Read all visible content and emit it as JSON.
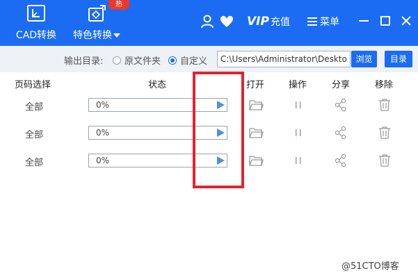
{
  "toolbar": {
    "cad_convert_label": "CAD转换",
    "special_convert_label": "特色转换",
    "hot_badge": "热",
    "vip_mark": "VIP",
    "vip_label": "充值",
    "menu_label": "菜单"
  },
  "output": {
    "label": "输出目录:",
    "option_original": "原文件夹",
    "option_custom": "自定义",
    "selected": "自定义",
    "path_value": "C:\\Users\\Administrator\\Deskto",
    "browse_label": "浏览",
    "directory_label": "目录"
  },
  "table": {
    "headers": {
      "pages": "页码选择",
      "status": "状态",
      "open": "打开",
      "operate": "操作",
      "share": "分享",
      "remove": "移除"
    },
    "rows": [
      {
        "pages": "全部",
        "progress_text": "0%",
        "progress": 0
      },
      {
        "pages": "全部",
        "progress_text": "0%",
        "progress": 0
      },
      {
        "pages": "全部",
        "progress_text": "0%",
        "progress": 0
      }
    ]
  },
  "watermark": "@51CTO博客",
  "colors": {
    "brand_blue": "#1b6cf2",
    "highlight_red": "#e0242c",
    "hot_red": "#e63a2e",
    "play_blue": "#4a90e2"
  }
}
